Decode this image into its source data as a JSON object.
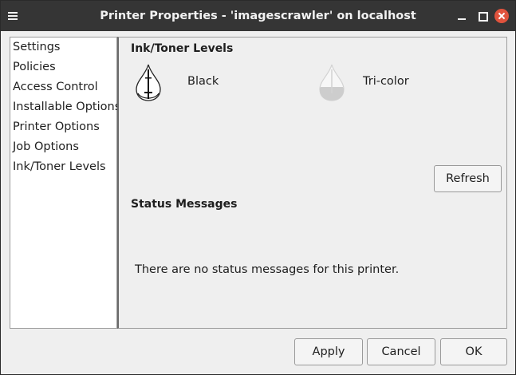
{
  "window": {
    "title": "Printer Properties - 'imagescrawler' on localhost"
  },
  "sidebar": {
    "items": [
      {
        "label": "Settings"
      },
      {
        "label": "Policies"
      },
      {
        "label": "Access Control"
      },
      {
        "label": "Installable Options"
      },
      {
        "label": "Printer Options"
      },
      {
        "label": "Job Options"
      },
      {
        "label": "Ink/Toner Levels"
      }
    ]
  },
  "ink": {
    "heading": "Ink/Toner Levels",
    "supplies": [
      {
        "name": "Black",
        "icon": "black-ink-drop-icon",
        "color": "#000000"
      },
      {
        "name": "Tri-color",
        "icon": "tri-color-ink-drop-icon",
        "color": "#c8c8c8"
      }
    ],
    "refresh_label": "Refresh"
  },
  "status": {
    "heading": "Status Messages",
    "message": "There are no status messages for this printer."
  },
  "footer": {
    "apply_label": "Apply",
    "cancel_label": "Cancel",
    "ok_label": "OK"
  },
  "colors": {
    "titlebar": "#353535",
    "close_button": "#e0533d",
    "dialog_background": "#efefef"
  }
}
